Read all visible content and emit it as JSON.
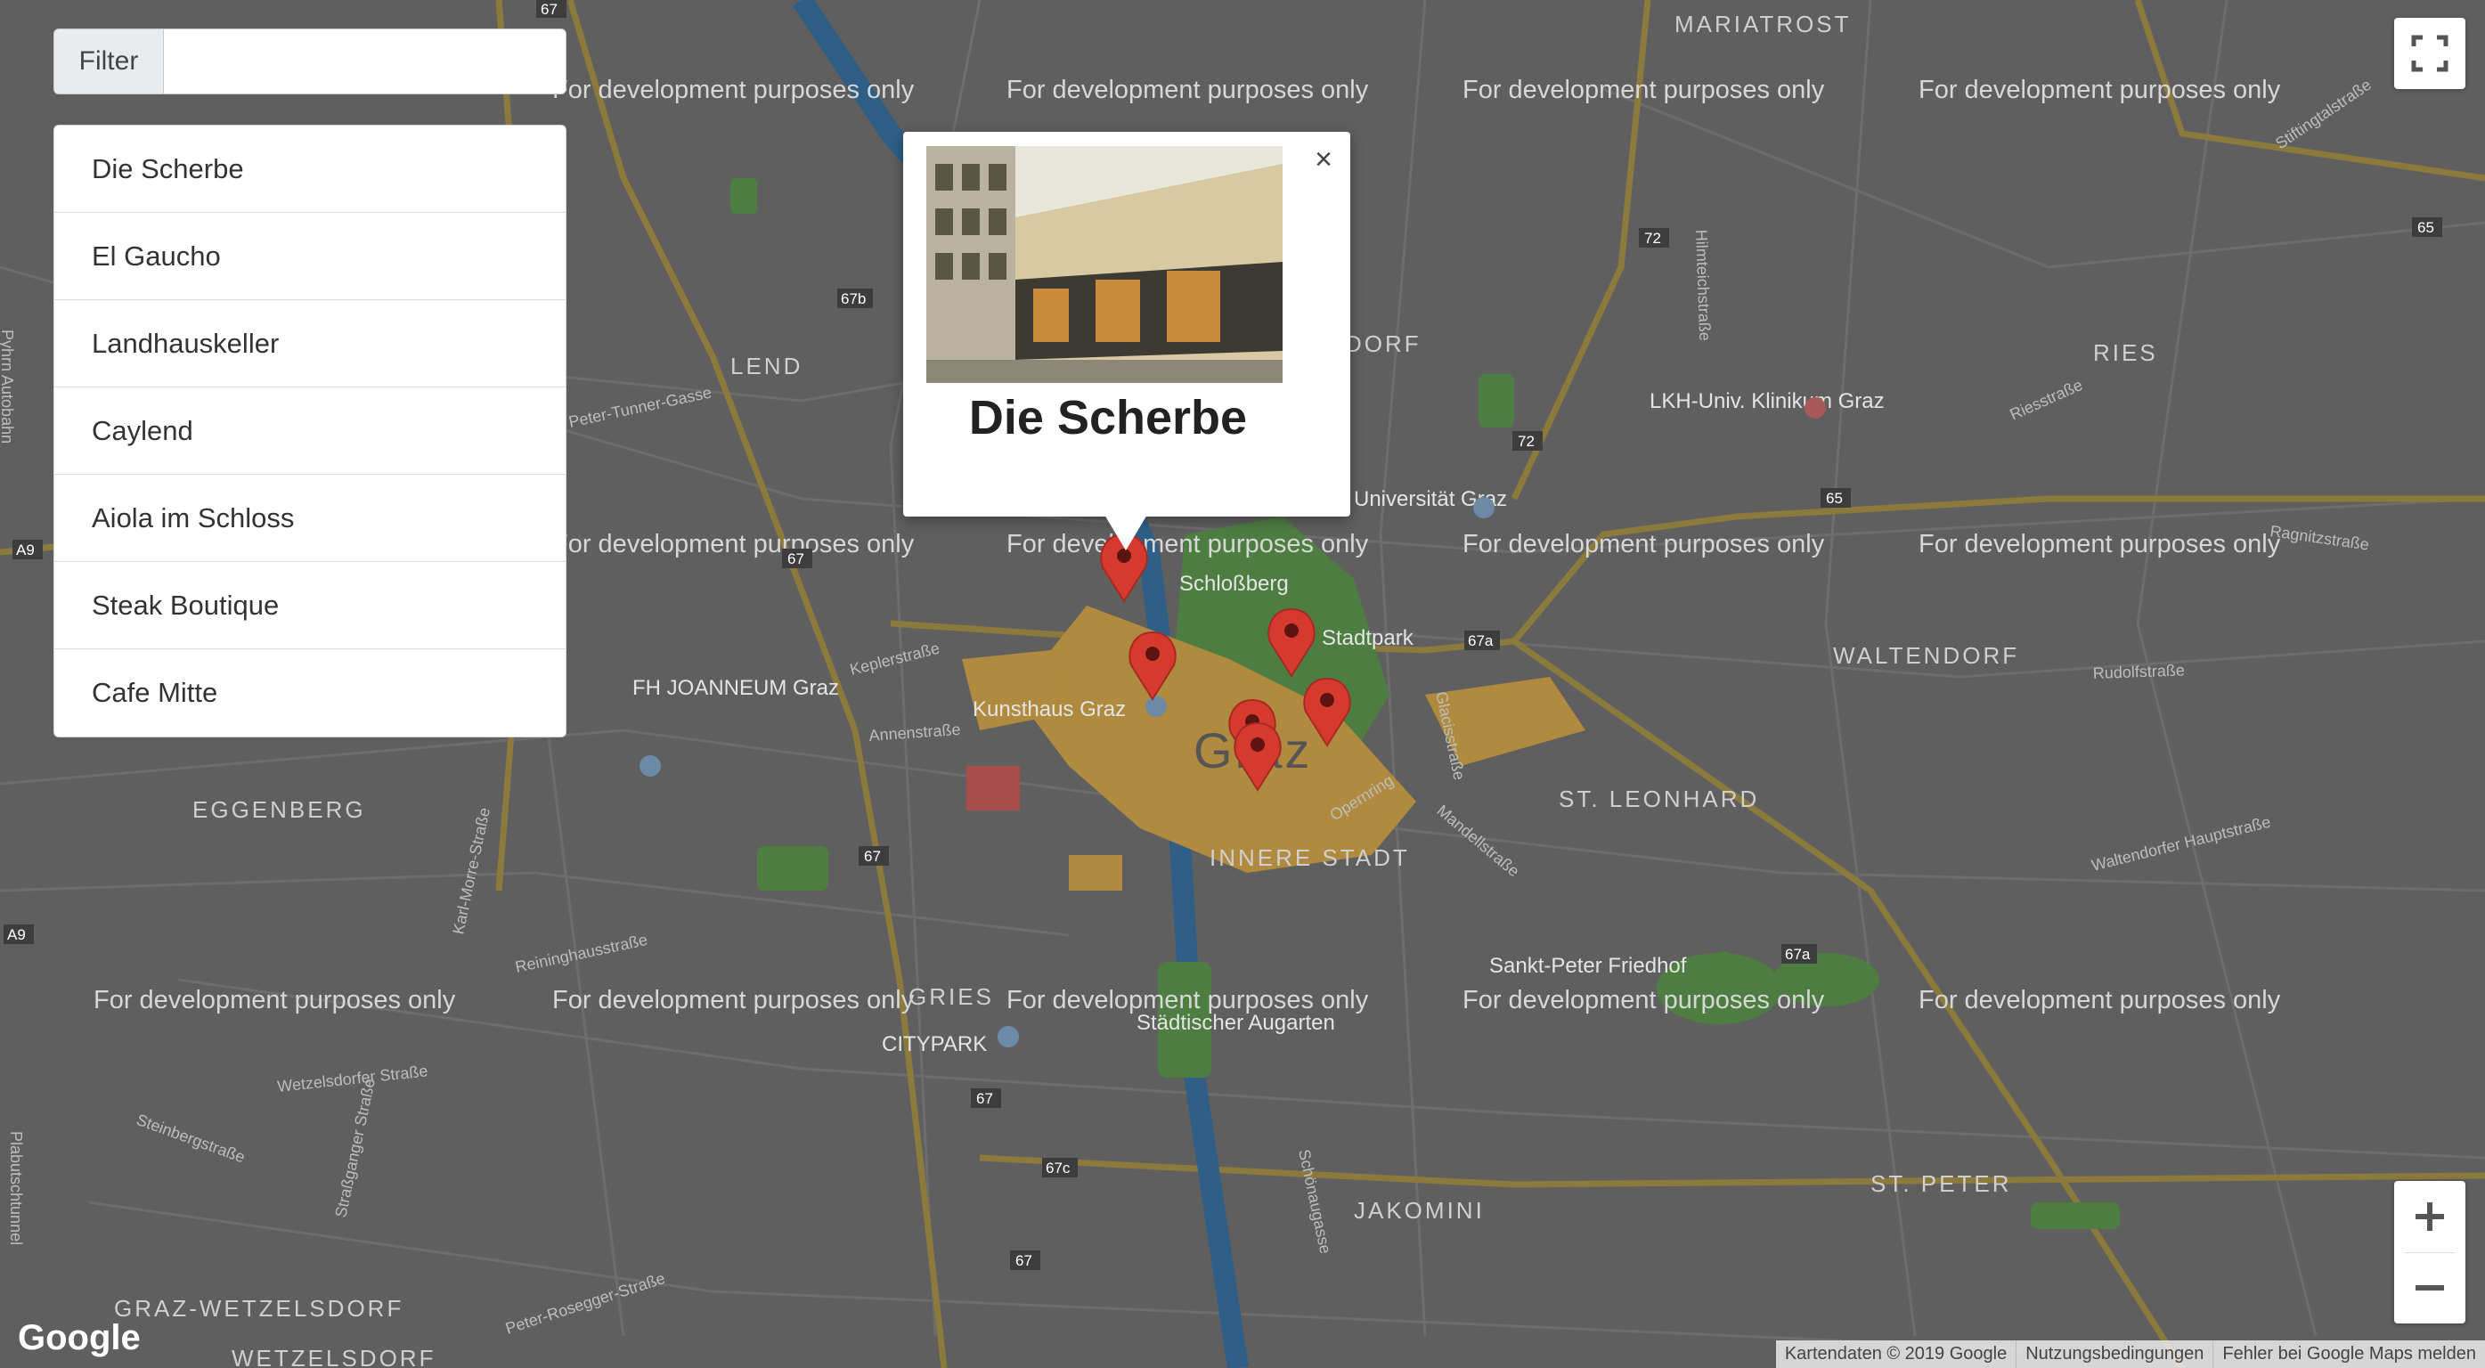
{
  "filter": {
    "label": "Filter",
    "value": "",
    "placeholder": ""
  },
  "places": [
    "Die Scherbe",
    "El Gaucho",
    "Landhauskeller",
    "Caylend",
    "Aiola im Schloss",
    "Steak Boutique",
    "Cafe Mitte"
  ],
  "info_window": {
    "title": "Die Scherbe",
    "close": "×"
  },
  "map": {
    "watermark": "For development purposes only",
    "districts": [
      "MARIATROST",
      "LEND",
      "DORF",
      "RIES",
      "WALTENDORF",
      "EGGENBERG",
      "ST. LEONHARD",
      "INNERE STADT",
      "GRIES",
      "JAKOMINI",
      "ST. PETER",
      "GRAZ-WETZELSDORF",
      "WETZELSDORF",
      "Graz"
    ],
    "pois": [
      "Schloßberg",
      "Stadtpark",
      "Kunsthaus Graz",
      "FH JOANNEUM Graz",
      "LKH-Univ. Klinikum Graz",
      "Universität Graz",
      "Sankt-Peter Friedhof",
      "CITYPARK",
      "Städtischer Augarten"
    ],
    "streets": [
      "Peter-Tunner-Gasse",
      "Annenstraße",
      "Keplerstraße",
      "Reininghausstraße",
      "Karl-Morre-Straße",
      "Wetzelsdorfer Straße",
      "Steinbergstraße",
      "Straßganger Straße",
      "Peter-Rosegger-Straße",
      "Rudolfstraße",
      "Waltendorfer Hauptstraße",
      "Ragnitzstraße",
      "Stiftingtalstraße",
      "Riesstraße",
      "Mandellstraße",
      "Glacisstraße",
      "Opernring",
      "Schönaugasse",
      "Hilmteichstraße",
      "Plabutschtunnel",
      "Pyhrn Autobahn"
    ],
    "road_shields": [
      "67",
      "67a",
      "67b",
      "67c",
      "72",
      "65",
      "A9"
    ],
    "accent_colors": {
      "marker": "#d63a2f",
      "water": "#2f5f86",
      "park": "#4e7d42",
      "center": "#b08b3f",
      "road": "#8c7a3c"
    }
  },
  "controls": {
    "fullscreen_icon": "fullscreen-icon",
    "zoom_in": "+",
    "zoom_out": "−"
  },
  "footer": {
    "logo": "Google",
    "map_data": "Kartendaten © 2019 Google",
    "terms": "Nutzungsbedingungen",
    "report": "Fehler bei Google Maps melden"
  }
}
